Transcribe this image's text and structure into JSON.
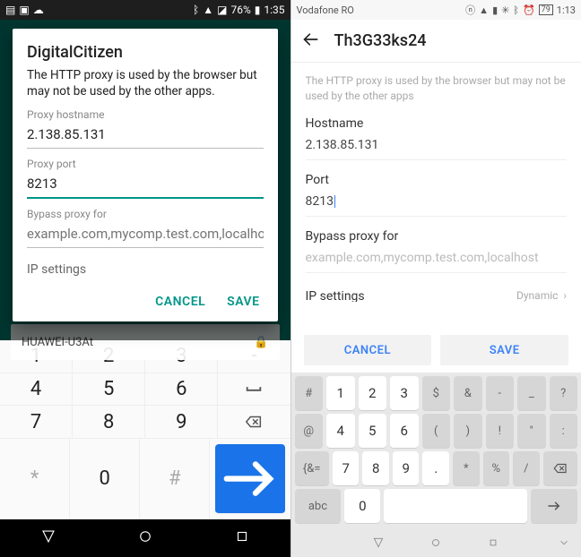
{
  "left": {
    "status": {
      "battery": "76%",
      "time": "1:35"
    },
    "bg_wifi": "HUAWEI-U3At",
    "dialog": {
      "title": "DigitalCitizen",
      "note": "The HTTP proxy is used by the browser but may not be used by the other apps.",
      "hostname_label": "Proxy hostname",
      "hostname_value": "2.138.85.131",
      "port_label": "Proxy port",
      "port_value": "8213",
      "bypass_label": "Bypass proxy for",
      "bypass_placeholder": "example.com,mycomp.test.com,localho",
      "ip_label": "IP settings",
      "cancel": "CANCEL",
      "save": "SAVE"
    },
    "keyboard": {
      "rows": [
        [
          "1",
          "2",
          "3",
          "-"
        ],
        [
          "4",
          "5",
          "6",
          "␣"
        ],
        [
          "7",
          "8",
          "9",
          "⌫"
        ],
        [
          "*",
          "0",
          "#",
          "→"
        ]
      ]
    }
  },
  "right": {
    "status": {
      "carrier": "Vodafone RO",
      "battery": "79",
      "time": "1:13"
    },
    "header_title": "Th3G33ks24",
    "note": "The HTTP proxy is used by the browser but may not be used by the other apps",
    "hostname_label": "Hostname",
    "hostname_value": "2.138.85.131",
    "port_label": "Port",
    "port_value": "8213",
    "bypass_label": "Bypass proxy for",
    "bypass_placeholder": "example.com,mycomp.test.com,localhost",
    "ip_label": "IP settings",
    "ip_value": "Dynamic",
    "cancel": "CANCEL",
    "save": "SAVE",
    "keyboard": {
      "row1": [
        "#",
        "1",
        "2",
        "3",
        "$",
        "&",
        "-",
        "_",
        "?"
      ],
      "row2": [
        "@",
        "4",
        "5",
        "6",
        "(",
        ")",
        "!",
        "\"",
        ":"
      ],
      "row3": [
        "{&=",
        "7",
        "8",
        "9",
        ".",
        "*",
        "%",
        "/",
        "⌫"
      ],
      "row4": [
        "abc",
        "0",
        "space",
        "→"
      ]
    }
  }
}
